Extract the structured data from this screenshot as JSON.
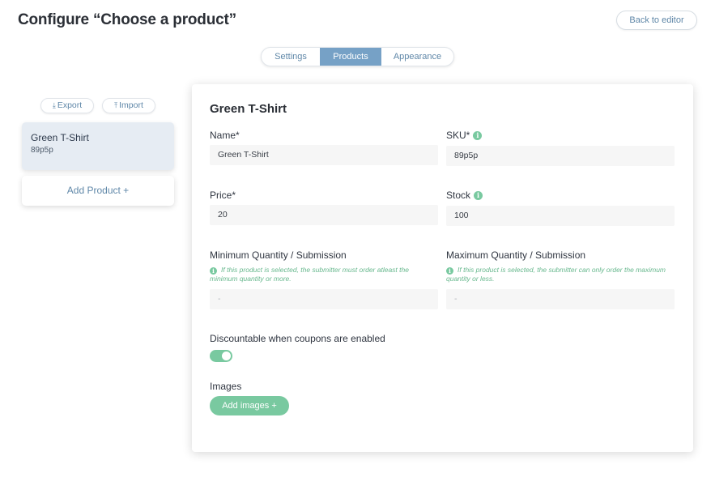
{
  "header": {
    "title": "Configure “Choose a product”",
    "back_label": "Back to editor"
  },
  "tabs": [
    {
      "label": "Settings",
      "active": false
    },
    {
      "label": "Products",
      "active": true
    },
    {
      "label": "Appearance",
      "active": false
    }
  ],
  "sidebar": {
    "export_label": "Export",
    "import_label": "Import",
    "products": [
      {
        "name": "Green T-Shirt",
        "sku": "89p5p",
        "selected": true
      }
    ],
    "add_product_label": "Add Product +"
  },
  "editor": {
    "title": "Green T-Shirt",
    "name": {
      "label": "Name*",
      "value": "Green T-Shirt"
    },
    "sku": {
      "label": "SKU*",
      "value": "89p5p"
    },
    "price": {
      "label": "Price*",
      "value": "20"
    },
    "stock": {
      "label": "Stock",
      "value": "100"
    },
    "min_qty": {
      "label": "Minimum Quantity / Submission",
      "hint": "If this product is selected, the submitter must order atleast the minimum quantity or more.",
      "placeholder": "-"
    },
    "max_qty": {
      "label": "Maximum Quantity / Submission",
      "hint": "If this product is selected, the submitter can only order the maximum quantity or less.",
      "placeholder": "-"
    },
    "discountable": {
      "label": "Discountable when coupons are enabled",
      "enabled": true
    },
    "images": {
      "label": "Images",
      "button_label": "Add images +"
    }
  },
  "icons": {
    "info": "i",
    "download": "⤓",
    "upload": "⤒"
  },
  "colors": {
    "accent": "#76a1c6",
    "success": "#79c9a0"
  }
}
